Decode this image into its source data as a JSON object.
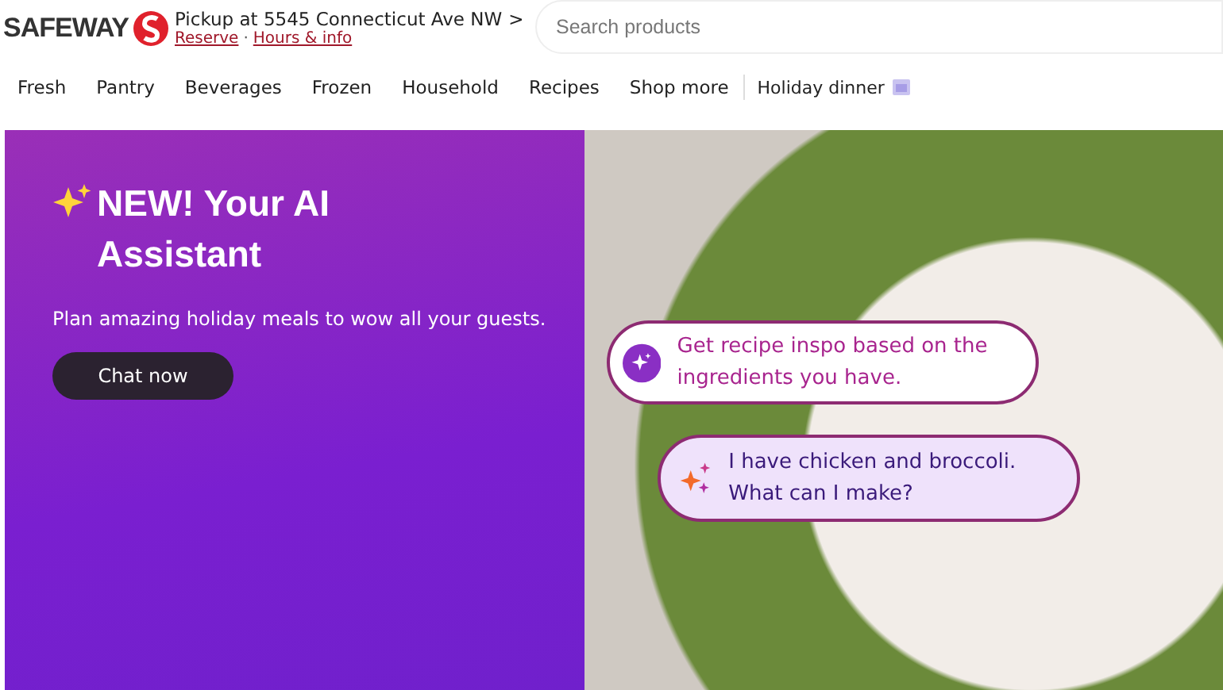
{
  "header": {
    "logo": "SAFEWAY",
    "pickup": "Pickup at 5545 Connecticut Ave NW",
    "chevron": ">",
    "links": [
      "Reserve",
      "Hours & info"
    ],
    "separator": "·",
    "search": {
      "placeholder": "Search products"
    }
  },
  "nav": {
    "items": [
      {
        "label": "Fresh"
      },
      {
        "label": "Pantry"
      },
      {
        "label": "Beverages"
      },
      {
        "label": "Frozen"
      },
      {
        "label": "Household"
      },
      {
        "label": "Recipes"
      },
      {
        "label": "Shop more"
      }
    ],
    "featured": "Holiday dinner"
  },
  "banner": {
    "title": "NEW! Your AI Assistant",
    "subtitle": "Plan amazing holiday meals to wow all your guests.",
    "button": "Chat now",
    "bubbles": [
      {
        "kind": "assistant",
        "text": "Get recipe inspo based on the ingredients you have."
      },
      {
        "kind": "user",
        "text": "I have chicken and broccoli. What can I make?"
      }
    ]
  }
}
